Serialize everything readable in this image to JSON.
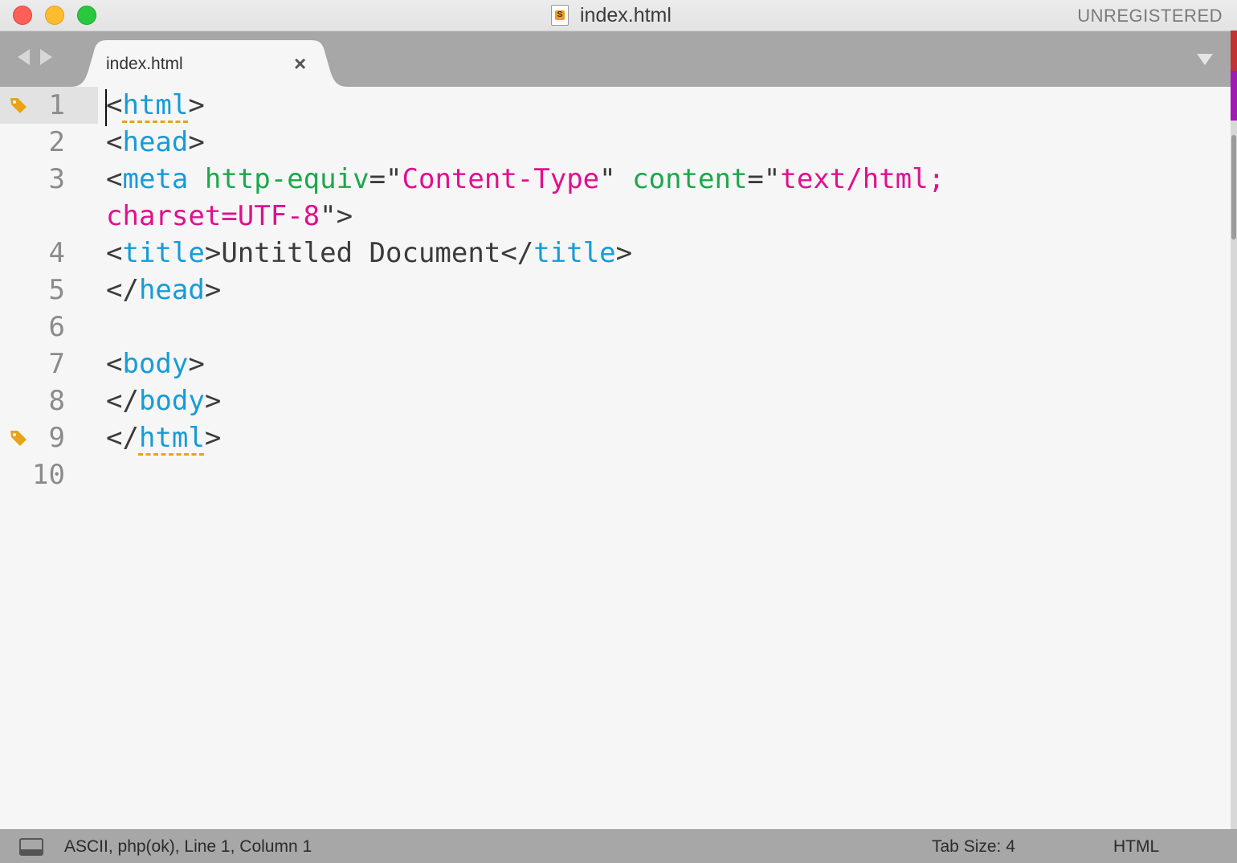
{
  "window": {
    "title": "index.html",
    "registration": "UNREGISTERED"
  },
  "tabs": [
    {
      "label": "index.html",
      "close_glyph": "×",
      "active": true
    }
  ],
  "editor": {
    "line_numbers": [
      "1",
      "2",
      "3",
      "",
      "4",
      "5",
      "6",
      "7",
      "8",
      "9",
      "10"
    ],
    "bookmarked_lines": [
      "1",
      "9"
    ],
    "current_line": "1",
    "lines": [
      [
        {
          "t": "<",
          "c": "punc"
        },
        {
          "t": "html",
          "c": "tag",
          "m": true
        },
        {
          "t": ">",
          "c": "punc"
        }
      ],
      [
        {
          "t": "<",
          "c": "punc"
        },
        {
          "t": "head",
          "c": "tag"
        },
        {
          "t": ">",
          "c": "punc"
        }
      ],
      [
        {
          "t": "<",
          "c": "punc"
        },
        {
          "t": "meta",
          "c": "tag"
        },
        {
          "t": " ",
          "c": "txt"
        },
        {
          "t": "http-equiv",
          "c": "attr"
        },
        {
          "t": "=\"",
          "c": "punc"
        },
        {
          "t": "Content-Type",
          "c": "str"
        },
        {
          "t": "\"",
          "c": "punc"
        },
        {
          "t": " ",
          "c": "txt"
        },
        {
          "t": "content",
          "c": "attr"
        },
        {
          "t": "=\"",
          "c": "punc"
        },
        {
          "t": "text/html;",
          "c": "str"
        }
      ],
      [
        {
          "t": "charset=UTF-8",
          "c": "str"
        },
        {
          "t": "\">",
          "c": "punc"
        }
      ],
      [
        {
          "t": "<",
          "c": "punc"
        },
        {
          "t": "title",
          "c": "tag"
        },
        {
          "t": ">",
          "c": "punc"
        },
        {
          "t": "Untitled Document",
          "c": "txt"
        },
        {
          "t": "</",
          "c": "punc"
        },
        {
          "t": "title",
          "c": "tag"
        },
        {
          "t": ">",
          "c": "punc"
        }
      ],
      [
        {
          "t": "</",
          "c": "punc"
        },
        {
          "t": "head",
          "c": "tag"
        },
        {
          "t": ">",
          "c": "punc"
        }
      ],
      [],
      [
        {
          "t": "<",
          "c": "punc"
        },
        {
          "t": "body",
          "c": "tag"
        },
        {
          "t": ">",
          "c": "punc"
        }
      ],
      [
        {
          "t": "</",
          "c": "punc"
        },
        {
          "t": "body",
          "c": "tag"
        },
        {
          "t": ">",
          "c": "punc"
        }
      ],
      [
        {
          "t": "</",
          "c": "punc"
        },
        {
          "t": "html",
          "c": "tag",
          "m": true
        },
        {
          "t": ">",
          "c": "punc"
        }
      ],
      []
    ],
    "colors": {
      "tag": "#179bd7",
      "attribute": "#1ca74b",
      "string": "#e0108e",
      "text": "#3b3b3b",
      "bookmark": "#e8a317"
    }
  },
  "statusbar": {
    "position": "ASCII, php(ok), Line 1, Column 1",
    "tab_size": "Tab Size: 4",
    "syntax": "HTML"
  },
  "icons": {
    "file": "sublime-file-icon",
    "bookmark": "tag-icon",
    "nav": [
      "back-arrow-icon",
      "forward-arrow-icon"
    ],
    "dropdown": "chevron-down-icon",
    "panel": "panel-toggle-icon"
  }
}
